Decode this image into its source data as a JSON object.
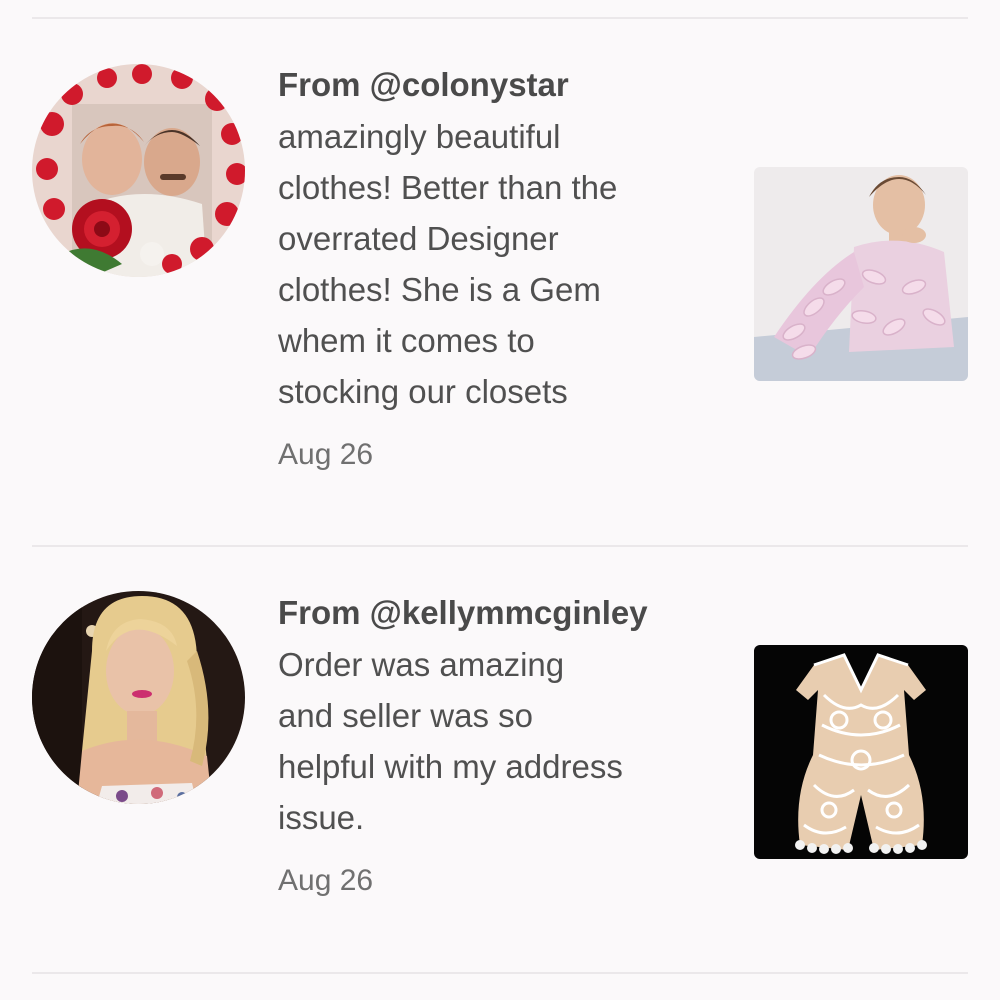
{
  "reviews": [
    {
      "from": "From @colonystar",
      "lines": [
        "amazingly beautiful",
        "clothes! Better than the",
        "overrated Designer",
        "clothes! She is a Gem",
        "whem it comes to",
        "stocking our closets"
      ],
      "date": "Aug 26"
    },
    {
      "from": "From @kellymmcginley",
      "lines": [
        "Order was amazing",
        "and seller was so",
        "helpful with my address",
        "issue."
      ],
      "date": "Aug 26"
    }
  ]
}
